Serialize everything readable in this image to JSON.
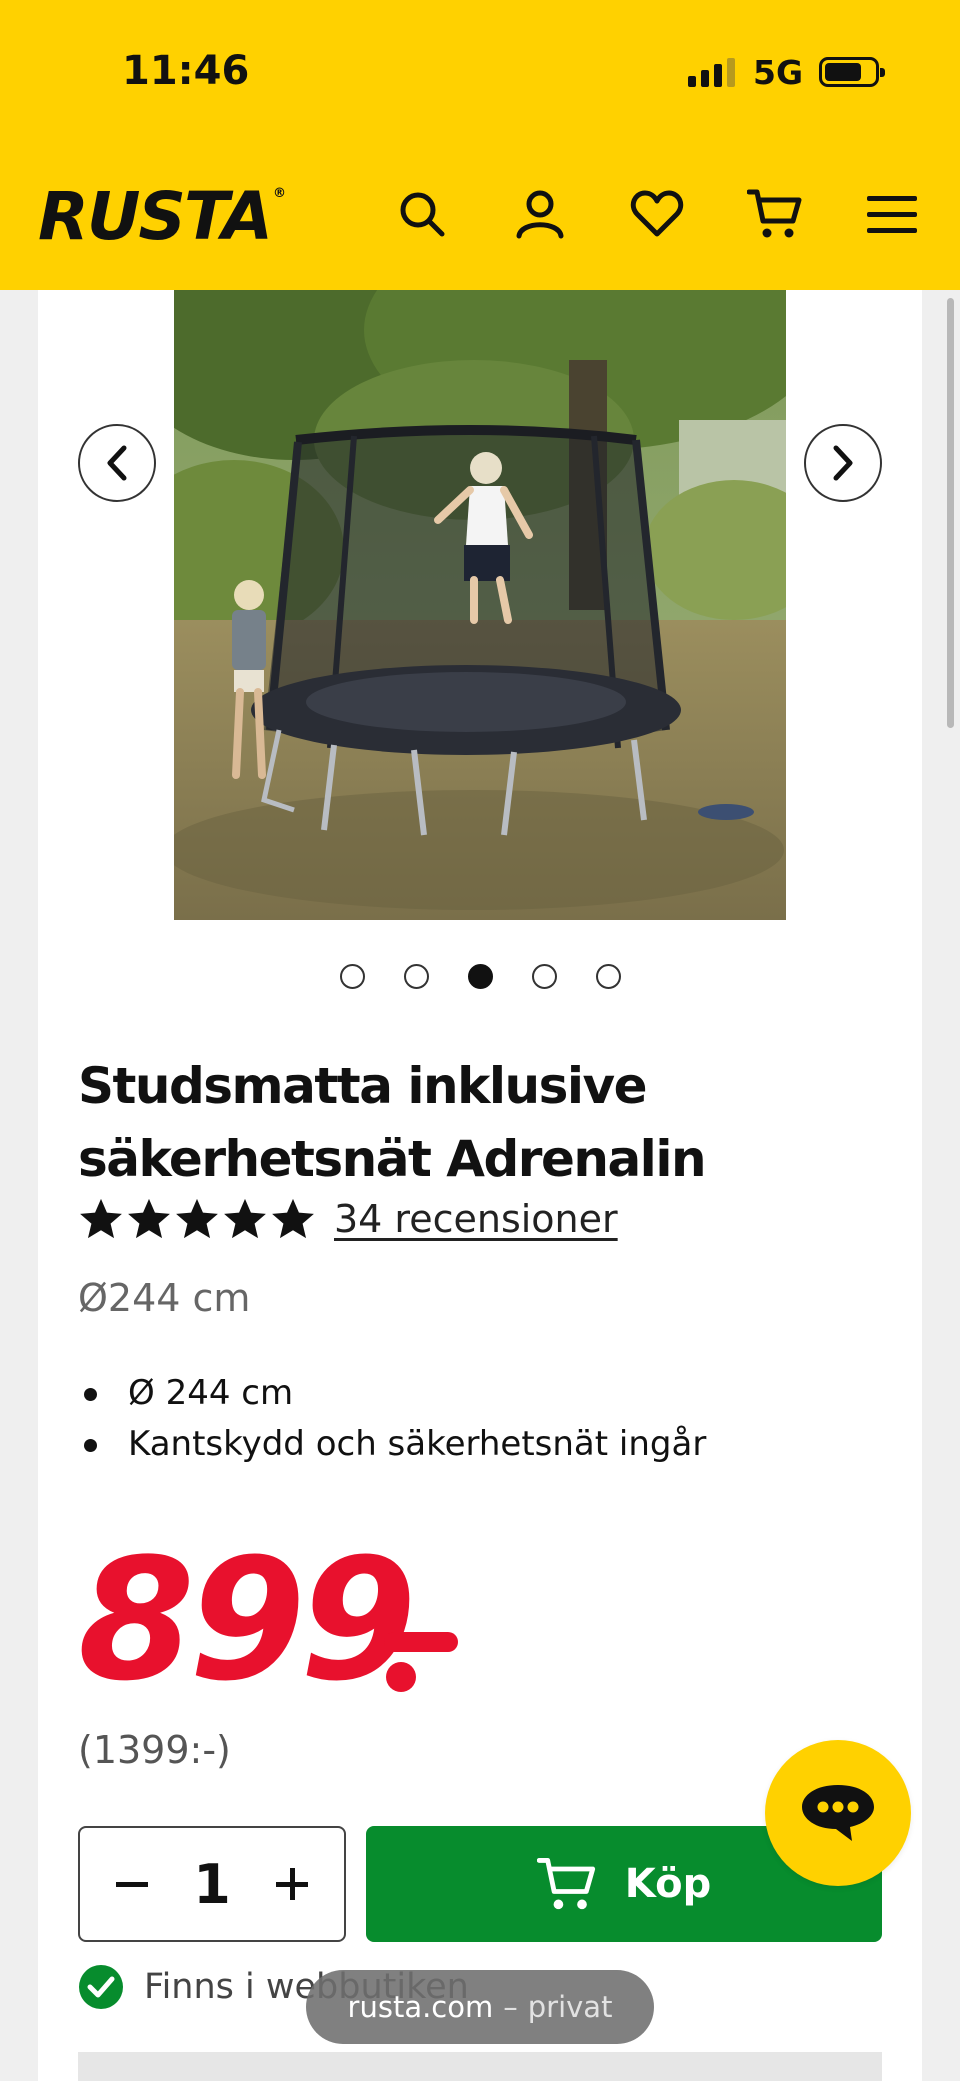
{
  "status_bar": {
    "time": "11:46",
    "network": "5G",
    "battery_level": 0.74
  },
  "header": {
    "logo": "RUSTA",
    "logo_mark": "®",
    "icons": [
      "search-icon",
      "account-icon",
      "heart-icon",
      "cart-icon",
      "menu-icon"
    ]
  },
  "gallery": {
    "image_count": 5,
    "active_index": 2
  },
  "product": {
    "title": "Studsmatta inklusive säkerhetsnät Adrenalin",
    "rating": 5,
    "max_rating": 5,
    "reviews_text": "34 recensioner",
    "dimension": "Ø244 cm",
    "features": [
      "Ø 244 cm",
      "Kantskydd och säkerhetsnät ingår"
    ],
    "price": "899",
    "original_price": "(1399:-)"
  },
  "purchase": {
    "quantity": "1",
    "buy_label": "Köp",
    "stock_text": "Finns i webbutiken"
  },
  "browser": {
    "url": "rusta.com",
    "separator": "–",
    "mode": "privat"
  },
  "colors": {
    "brand_yellow": "#ffd100",
    "price_red": "#e8112d",
    "buy_green": "#078c2d"
  }
}
